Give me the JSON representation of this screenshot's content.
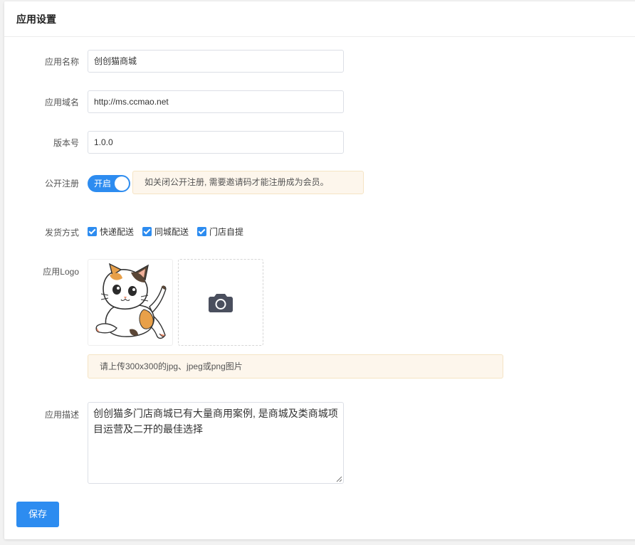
{
  "header": {
    "title": "应用设置"
  },
  "form": {
    "app_name": {
      "label": "应用名称",
      "value": "创创猫商城"
    },
    "app_domain": {
      "label": "应用域名",
      "value": "http://ms.ccmao.net"
    },
    "version": {
      "label": "版本号",
      "value": "1.0.0"
    },
    "public_register": {
      "label": "公开注册",
      "switch_text": "开启",
      "enabled": true,
      "tip": "如关闭公开注册, 需要邀请码才能注册成为会员。"
    },
    "delivery": {
      "label": "发货方式",
      "options": [
        {
          "label": "快递配送",
          "checked": true
        },
        {
          "label": "同城配送",
          "checked": true
        },
        {
          "label": "门店自提",
          "checked": true
        }
      ]
    },
    "logo": {
      "label": "应用Logo",
      "image_icon": "cat-logo-icon",
      "upload_icon": "camera-icon",
      "tip": "请上传300x300的jpg、jpeg或png图片"
    },
    "description": {
      "label": "应用描述",
      "value": "创创猫多门店商城已有大量商用案例, 是商城及类商城项目运营及二开的最佳选择"
    }
  },
  "actions": {
    "save_label": "保存"
  },
  "colors": {
    "primary": "#2d8cf0",
    "tip_bg": "#fdf6ec"
  }
}
